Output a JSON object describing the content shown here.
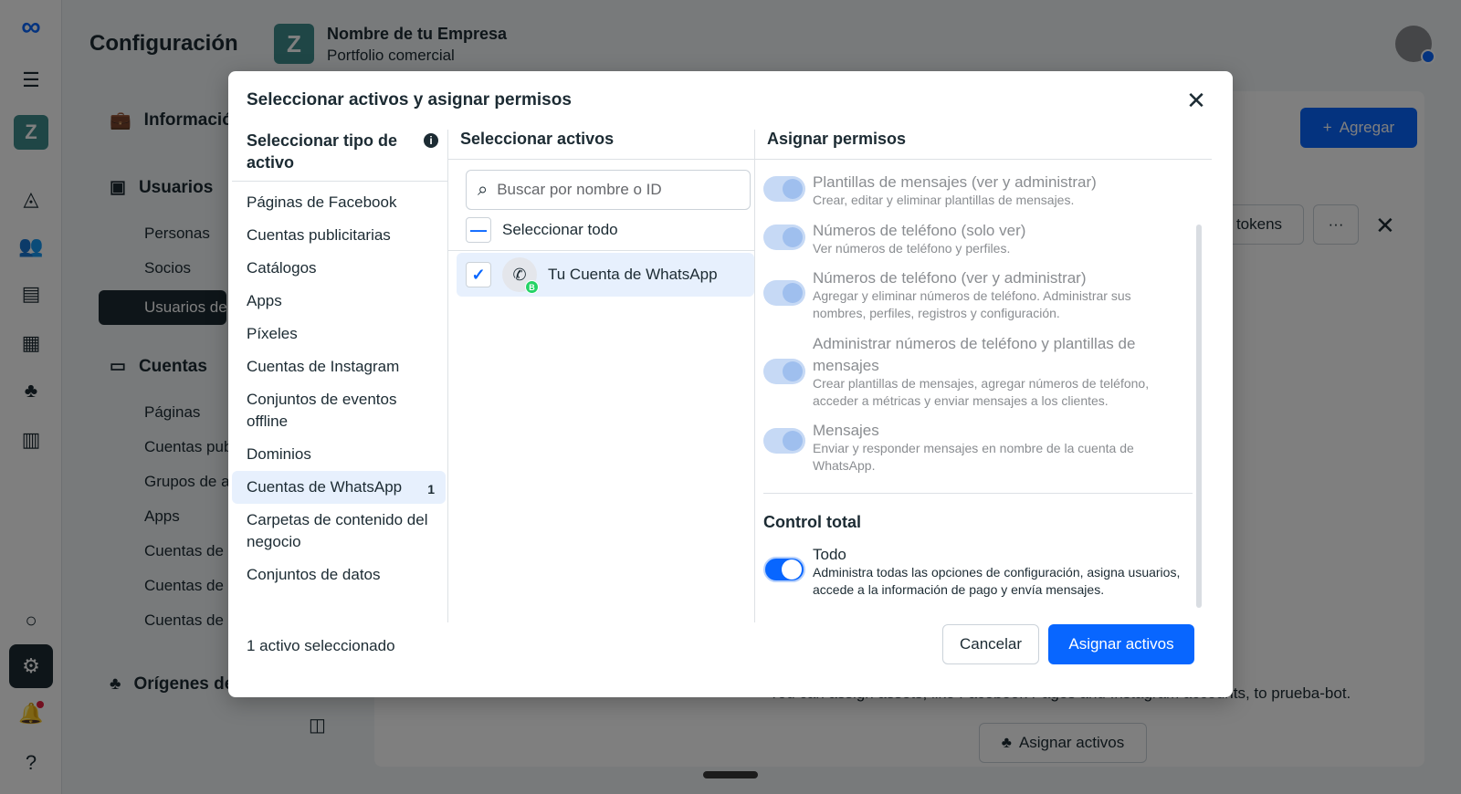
{
  "app": {
    "title": "Configuración",
    "business": {
      "badge": "Z",
      "name": "Nombre de tu Empresa",
      "subtitle": "Portfolio comercial"
    },
    "rail": {
      "workspace": "Z"
    },
    "nav": {
      "info": "Informació",
      "users": "Usuarios",
      "people": "Personas",
      "partners": "Socios",
      "system_users": "Usuarios de",
      "accounts": "Cuentas",
      "pages": "Páginas",
      "ad_accounts": "Cuentas pub",
      "groups": "Grupos de a",
      "apps": "Apps",
      "acc1": "Cuentas de",
      "acc2": "Cuentas de",
      "acc3": "Cuentas de",
      "data_sources": "Orígenes de datos"
    },
    "buttons": {
      "add": "Agregar",
      "tokens": "tokens",
      "more": "···",
      "assign_assets": "Asignar activos"
    },
    "hint_text": "You can assign assets, like Facebook Pages and Instagram accounts, to prueba-bot."
  },
  "modal": {
    "title": "Seleccionar activos y asignar permisos",
    "col1": {
      "heading": "Seleccionar tipo de activo",
      "items": [
        {
          "label": "Páginas de Facebook",
          "count": ""
        },
        {
          "label": "Cuentas publicitarias",
          "count": ""
        },
        {
          "label": "Catálogos",
          "count": ""
        },
        {
          "label": "Apps",
          "count": ""
        },
        {
          "label": "Píxeles",
          "count": ""
        },
        {
          "label": "Cuentas de Instagram",
          "count": ""
        },
        {
          "label": "Conjuntos de eventos offline",
          "count": ""
        },
        {
          "label": "Dominios",
          "count": ""
        },
        {
          "label": "Cuentas de WhatsApp",
          "count": "1"
        },
        {
          "label": "Carpetas de contenido del negocio",
          "count": ""
        },
        {
          "label": "Conjuntos de datos",
          "count": ""
        }
      ]
    },
    "col2": {
      "heading": "Seleccionar activos",
      "search_placeholder": "Buscar por nombre o ID",
      "select_all": "Seleccionar todo",
      "asset": "Tu Cuenta de WhatsApp"
    },
    "col3": {
      "heading": "Asignar permisos",
      "permissions": [
        {
          "name": "Plantillas de mensajes (ver y administrar)",
          "desc": "Crear, editar y eliminar plantillas de mensajes."
        },
        {
          "name": "Números de teléfono (solo ver)",
          "desc": "Ver números de teléfono y perfiles."
        },
        {
          "name": "Números de teléfono (ver y administrar)",
          "desc": "Agregar y eliminar números de teléfono. Administrar sus nombres, perfiles, registros y configuración."
        },
        {
          "name": "Administrar números de teléfono y plantillas de mensajes",
          "desc": "Crear plantillas de mensajes, agregar números de teléfono, acceder a métricas y enviar mensajes a los clientes."
        },
        {
          "name": "Mensajes",
          "desc": "Enviar y responder mensajes en nombre de la cuenta de WhatsApp."
        }
      ],
      "control_heading": "Control total",
      "control": {
        "name": "Todo",
        "desc": "Administra todas las opciones de configuración, asigna usuarios, accede a la información de pago y envía mensajes."
      }
    },
    "footer": {
      "selected": "1 activo seleccionado",
      "cancel": "Cancelar",
      "assign": "Asignar activos"
    }
  },
  "colors": {
    "accent": "#0866ff",
    "selected_bg": "#e7f0fd",
    "workspace": "#3f8c8d",
    "text": "#1c2b33"
  }
}
